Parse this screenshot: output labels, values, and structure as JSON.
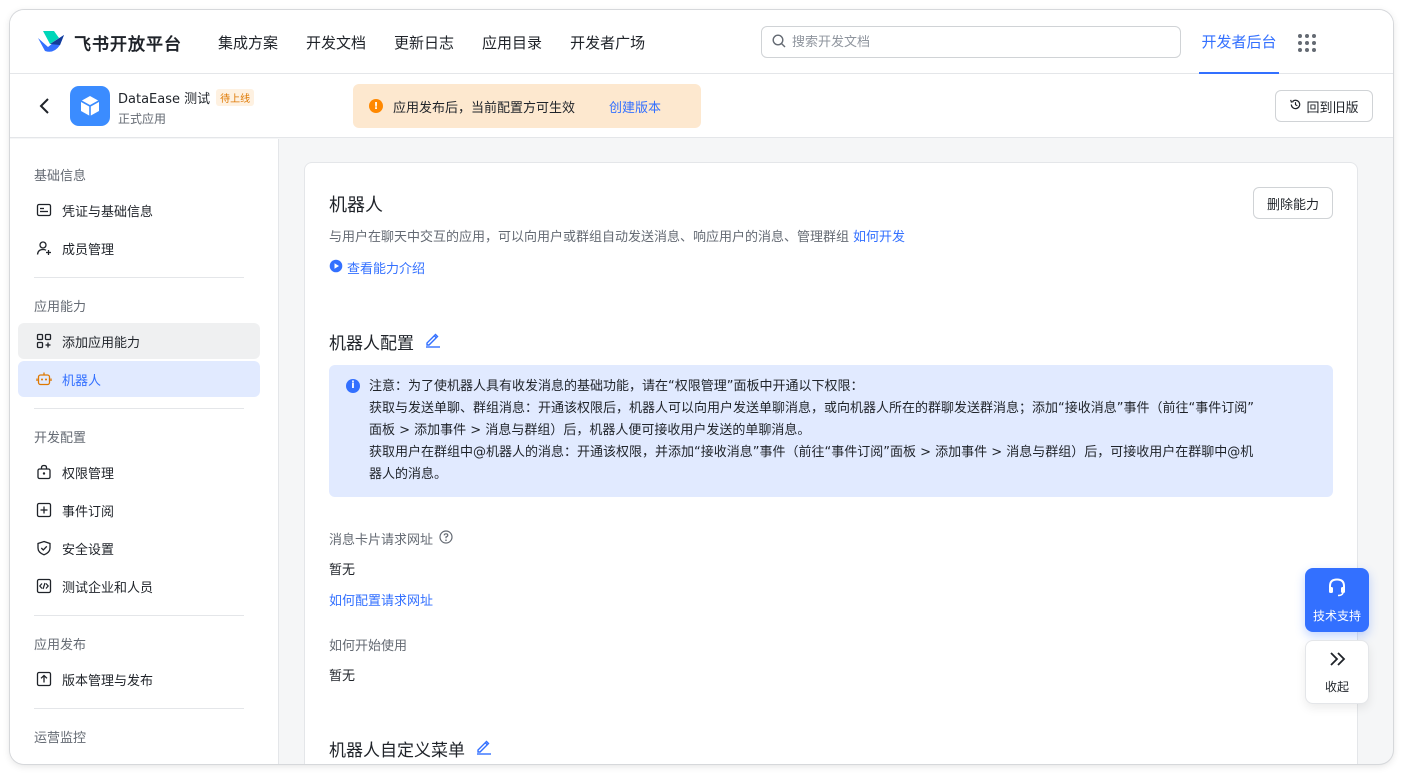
{
  "brand": {
    "name": "飞书开放平台"
  },
  "nav": {
    "links": [
      "集成方案",
      "开发文档",
      "更新日志",
      "应用目录",
      "开发者广场"
    ],
    "search_placeholder": "搜索开发文档",
    "console": "开发者后台"
  },
  "app": {
    "name": "DataEase 测试",
    "status_badge": "待上线",
    "type": "正式应用"
  },
  "notice": {
    "text": "应用发布后，当前配置方可生效",
    "link": "创建版本"
  },
  "old_version_button": "回到旧版",
  "sidebar": {
    "sections": [
      {
        "title": "基础信息",
        "items": [
          "凭证与基础信息",
          "成员管理"
        ]
      },
      {
        "title": "应用能力",
        "items": [
          "添加应用能力",
          "机器人"
        ]
      },
      {
        "title": "开发配置",
        "items": [
          "权限管理",
          "事件订阅",
          "安全设置",
          "测试企业和人员"
        ]
      },
      {
        "title": "应用发布",
        "items": [
          "版本管理与发布"
        ]
      },
      {
        "title": "运营监控",
        "items": []
      }
    ]
  },
  "main": {
    "title": "机器人",
    "description": "与用户在聊天中交互的应用，可以向用户或群组自动发送消息、响应用户的消息、管理群组",
    "how_to_link": "如何开发",
    "intro_link": "查看能力介绍",
    "delete_button": "删除能力",
    "config_title": "机器人配置",
    "info": {
      "line1": "注意：为了使机器人具有收发消息的基础功能，请在“权限管理”面板中开通以下权限：",
      "line2": "获取与发送单聊、群组消息：开通该权限后，机器人可以向用户发送单聊消息，或向机器人所在的群聊发送群消息；添加“接收消息”事件（前往“事件订阅”",
      "line3": "面板 > 添加事件 > 消息与群组）后，机器人便可接收用户发送的单聊消息。",
      "line4": "获取用户在群组中@机器人的消息：开通该权限，并添加“接收消息”事件（前往“事件订阅”面板 > 添加事件 > 消息与群组）后，可接收用户在群聊中@机",
      "line5": "器人的消息。"
    },
    "card_url_label": "消息卡片请求网址",
    "card_url_value": "暂无",
    "card_url_link": "如何配置请求网址",
    "start_label": "如何开始使用",
    "start_value": "暂无",
    "menu_title": "机器人自定义菜单"
  },
  "floating": {
    "support": "技术支持",
    "collapse": "收起"
  }
}
